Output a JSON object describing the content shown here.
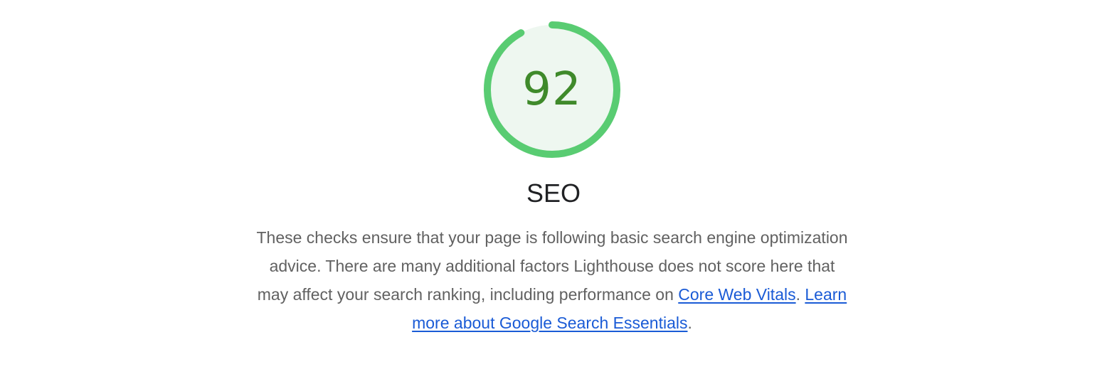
{
  "gauge": {
    "score": "92",
    "fraction": 0.92,
    "arc_color": "#59cc72",
    "fill_color": "#eef7f0",
    "text_color": "#3f8a2b"
  },
  "category": {
    "title": "SEO"
  },
  "description": {
    "text": "These checks ensure that your page is following basic search engine optimization advice. There are many additional factors Lighthouse does not score here that may affect your search ranking, including performance on",
    "link1_label": "Core Web Vitals",
    "separator": ".",
    "link2_label": "Learn more about Google Search Essentials",
    "end": "."
  },
  "colors": {
    "link": "#1a5bd6",
    "body_text": "#616161",
    "heading": "#202124"
  }
}
